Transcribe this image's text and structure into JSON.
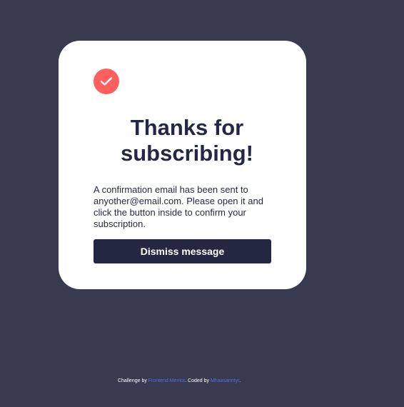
{
  "card": {
    "icon": "checkmark-circle-icon",
    "title_line1": "Thanks for",
    "title_line2": "subscribing!",
    "message": "A confirmation email has been sent to anyother@email.com. Please open it and click the button inside to confirm your subscription.",
    "dismiss_label": "Dismiss message"
  },
  "footer": {
    "challenge_prefix": "Challenge by ",
    "challenge_link": "Frontend Mentor",
    "coded_prefix": ". Coded by ",
    "coded_link": "Mhaasanntyr",
    "suffix": "."
  },
  "colors": {
    "background": "#383b50",
    "card": "#ffffff",
    "accent": "#ff5f5d",
    "primary_text": "#242844",
    "button": "#242742",
    "link": "#5a6de0"
  }
}
